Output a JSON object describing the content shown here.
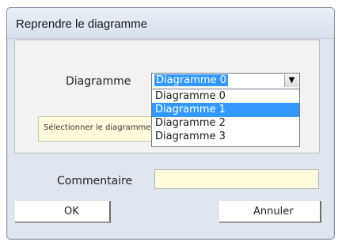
{
  "dialog": {
    "title": "Reprendre le diagramme",
    "diagram_label": "Diagramme",
    "diagram_select": {
      "value": "Diagramme 0",
      "options": [
        "Diagramme 0",
        "Diagramme 1",
        "Diagramme 2",
        "Diagramme 3"
      ],
      "highlighted": "Diagramme 1"
    },
    "notice_text": "Sélectionner le diagramme",
    "comment_label": "Commentaire",
    "comment_value": "",
    "ok_label": "OK",
    "cancel_label": "Annuler"
  },
  "colors": {
    "dialog_bg": "#dfe6ef",
    "selection": "#3399ff",
    "notice_bg": "#fffbdc"
  }
}
